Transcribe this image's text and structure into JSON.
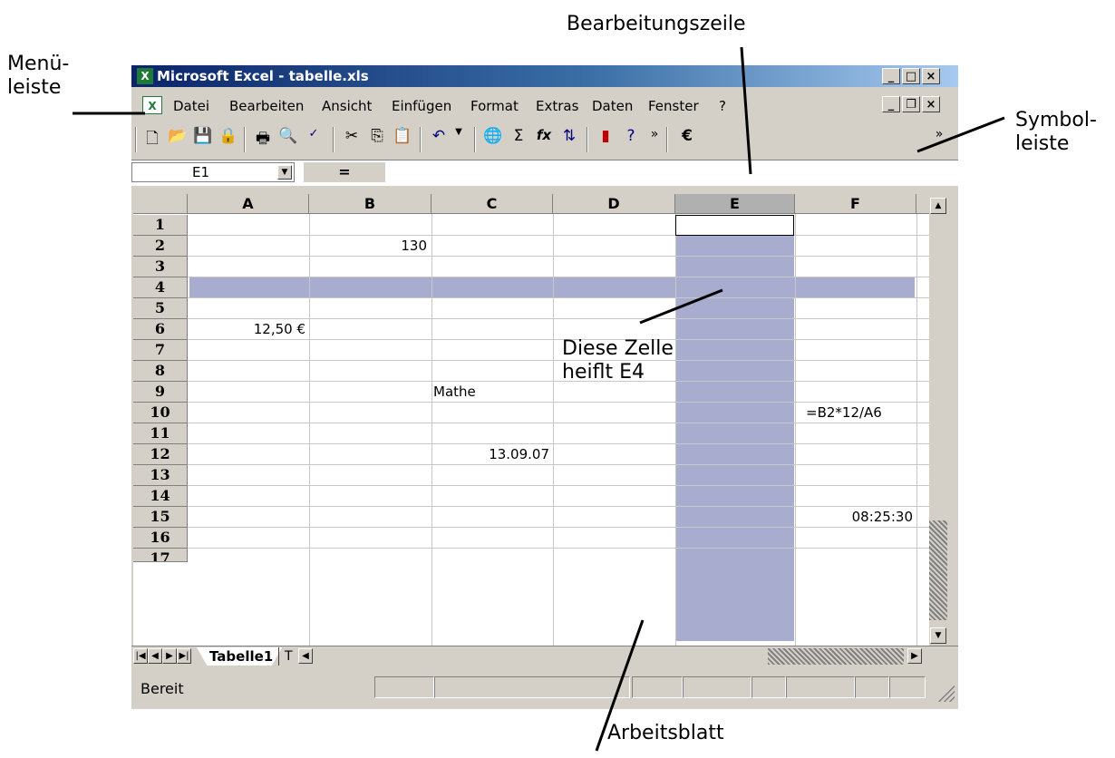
{
  "annotations": {
    "menu_bar": [
      "Menü-",
      "leiste"
    ],
    "formula_bar": "Bearbeitungszeile",
    "toolbar": [
      "Symbol-",
      "leiste"
    ],
    "cell_note": [
      "Diese Zelle",
      "heiflt E4"
    ],
    "worksheet": "Arbeitsblatt"
  },
  "window": {
    "title": "Microsoft Excel - tabelle.xls",
    "title_icon": "excel-icon",
    "caption_buttons": [
      "minimize",
      "maximize",
      "close"
    ],
    "doc_buttons": [
      "minimize",
      "restore",
      "close"
    ]
  },
  "menu": {
    "items": [
      {
        "label": "Datei"
      },
      {
        "label": "Bearbeiten"
      },
      {
        "label": "Ansicht"
      },
      {
        "label": "Einfügen"
      },
      {
        "label": "Format"
      },
      {
        "label": "Extras"
      },
      {
        "label": "Daten"
      },
      {
        "label": "Fenster"
      },
      {
        "label": "?"
      }
    ]
  },
  "toolbar": {
    "icons": [
      "new-icon",
      "open-icon",
      "save-icon",
      "permission-icon",
      "print-icon",
      "print-preview-icon",
      "spelling-icon",
      "cut-icon",
      "copy-icon",
      "paste-icon",
      "undo-icon",
      "hyperlink-icon",
      "autosum-icon",
      "function-icon",
      "sort-ascending-icon",
      "chart-wizard-icon",
      "help-icon",
      "more-icon",
      "euro-icon",
      "options-icon"
    ],
    "euro_label": "€",
    "sum_label": "Σ",
    "fx_label": "fx"
  },
  "formula_bar": {
    "name_box": "E1",
    "equals": "=",
    "content": ""
  },
  "grid": {
    "columns": [
      "A",
      "B",
      "C",
      "D",
      "E",
      "F"
    ],
    "rows": [
      "1",
      "2",
      "3",
      "4",
      "5",
      "6",
      "7",
      "8",
      "9",
      "10",
      "11",
      "12",
      "13",
      "14",
      "15",
      "16",
      "17"
    ],
    "selected_column": "E",
    "highlight_row": "3",
    "active_cell": "E1",
    "cells": {
      "B2": "130",
      "A6": "12,50 €",
      "C9": "Mathe",
      "F10": "=B2*12/A6",
      "C12": "13.09.07",
      "F15": "08:25:30"
    }
  },
  "sheet_tabs": {
    "active": "Tabelle1",
    "next": "T"
  },
  "status": {
    "text": "Bereit"
  },
  "colors": {
    "highlight": "#a8acce",
    "title_start": "#0a246a",
    "title_end": "#a6caf0",
    "chrome": "#d4d0c8"
  }
}
